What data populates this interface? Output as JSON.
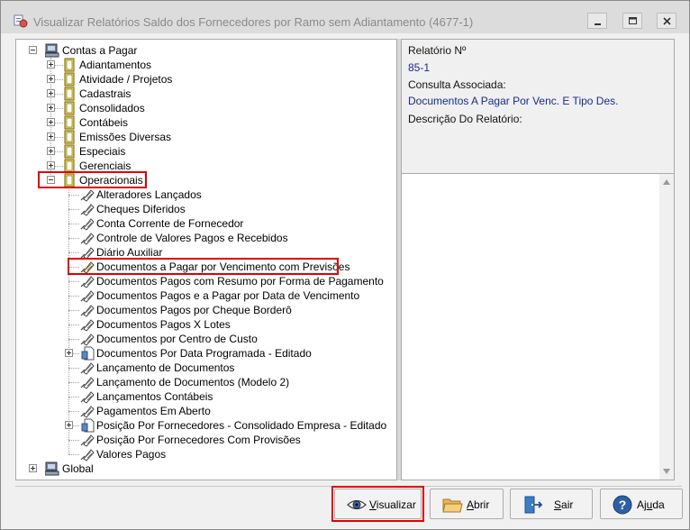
{
  "window": {
    "title": "Visualizar Relatórios Saldo dos Fornecedores por Ramo sem Adiantamento (4677-1)"
  },
  "tree": {
    "root": "Contas a Pagar",
    "categories": [
      "Adiantamentos",
      "Atividade / Projetos",
      "Cadastrais",
      "Consolidados",
      "Contábeis",
      "Emissões Diversas",
      "Especiais",
      "Gerenciais"
    ],
    "selected_category": "Operacionais",
    "reports": [
      {
        "label": "Alteradores Lançados",
        "expandable": false
      },
      {
        "label": "Cheques Diferidos",
        "expandable": false
      },
      {
        "label": "Conta Corrente de Fornecedor",
        "expandable": false
      },
      {
        "label": "Controle de Valores Pagos e Recebidos",
        "expandable": false
      },
      {
        "label": "Diário Auxiliar",
        "expandable": false
      },
      {
        "label": "Documentos a Pagar por Vencimento com Previsões",
        "expandable": false,
        "highlighted": true
      },
      {
        "label": "Documentos Pagos com Resumo por Forma de Pagamento",
        "expandable": false
      },
      {
        "label": "Documentos Pagos e a Pagar por Data de Vencimento",
        "expandable": false
      },
      {
        "label": "Documentos Pagos por Cheque Borderô",
        "expandable": false
      },
      {
        "label": "Documentos Pagos X Lotes",
        "expandable": false
      },
      {
        "label": "Documentos por Centro de Custo",
        "expandable": false
      },
      {
        "label": "Documentos Por Data Programada - Editado",
        "expandable": true
      },
      {
        "label": "Lançamento de Documentos",
        "expandable": false
      },
      {
        "label": "Lançamento de Documentos (Modelo 2)",
        "expandable": false
      },
      {
        "label": "Lançamentos Contábeis",
        "expandable": false
      },
      {
        "label": "Pagamentos Em Aberto",
        "expandable": false
      },
      {
        "label": "Posição Por Fornecedores - Consolidado Empresa - Editado",
        "expandable": true
      },
      {
        "label": "Posição Por Fornecedores Com Provisões",
        "expandable": false
      },
      {
        "label": "Valores Pagos",
        "expandable": false
      }
    ],
    "second_root": "Global"
  },
  "info": {
    "report_label": "Relatório Nº",
    "report_value": "85-1",
    "query_label": "Consulta Associada:",
    "query_value": "Documentos A Pagar Por Venc. E Tipo Des.",
    "desc_label": "Descrição Do Relatório:"
  },
  "buttons": {
    "view_prefix": "V",
    "view_rest": "isualizar",
    "open_prefix": "A",
    "open_rest": "brir",
    "exit_prefix": "S",
    "exit_rest": "air",
    "help_prefix": "Aj",
    "help_u": "u",
    "help_rest": "da"
  },
  "colors": {
    "highlight_border": "#e00000",
    "link_text": "#1a2a8e",
    "folder_yellow": "#f5e24a",
    "report_icon": "#555555"
  }
}
